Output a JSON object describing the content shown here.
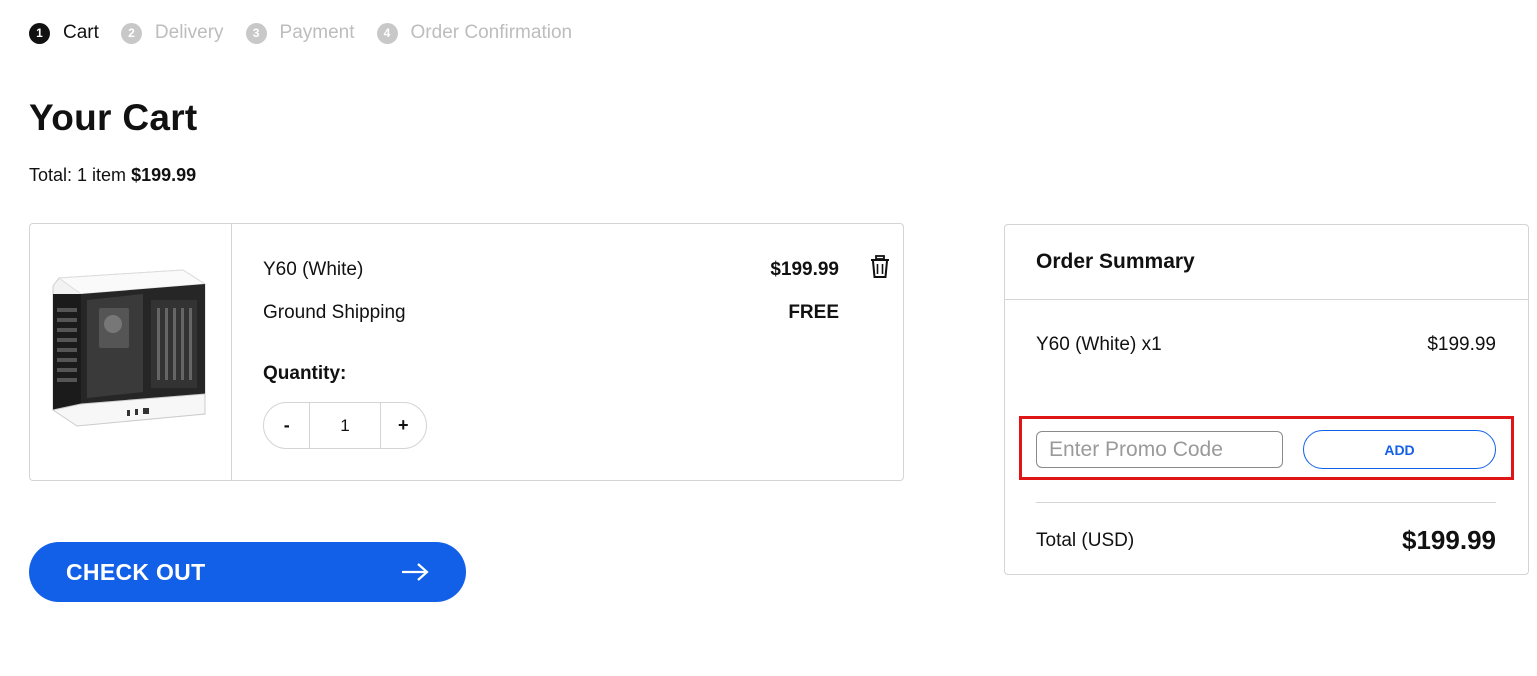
{
  "stepper": {
    "steps": [
      {
        "num": "1",
        "label": "Cart",
        "active": true
      },
      {
        "num": "2",
        "label": "Delivery",
        "active": false
      },
      {
        "num": "3",
        "label": "Payment",
        "active": false
      },
      {
        "num": "4",
        "label": "Order Confirmation",
        "active": false
      }
    ]
  },
  "page": {
    "title": "Your Cart",
    "total_prefix": "Total: 1 item",
    "total_amount": "$199.99"
  },
  "cart_item": {
    "image_icon": "pc-case-image",
    "name": "Y60 (White)",
    "price": "$199.99",
    "shipping_label": "Ground Shipping",
    "shipping_value": "FREE",
    "quantity_label": "Quantity:",
    "quantity_value": "1",
    "decrement_label": "-",
    "increment_label": "+",
    "remove_icon": "trash-icon"
  },
  "checkout": {
    "label": "CHECK OUT",
    "icon": "arrow-right-icon",
    "color": "#1360e8"
  },
  "summary": {
    "title": "Order Summary",
    "item_line": "Y60 (White) x1",
    "item_price": "$199.99",
    "promo_placeholder": "Enter Promo Code",
    "promo_value": "",
    "add_label": "ADD",
    "total_label": "Total (USD)",
    "total_value": "$199.99",
    "highlight_color": "#e01616"
  }
}
